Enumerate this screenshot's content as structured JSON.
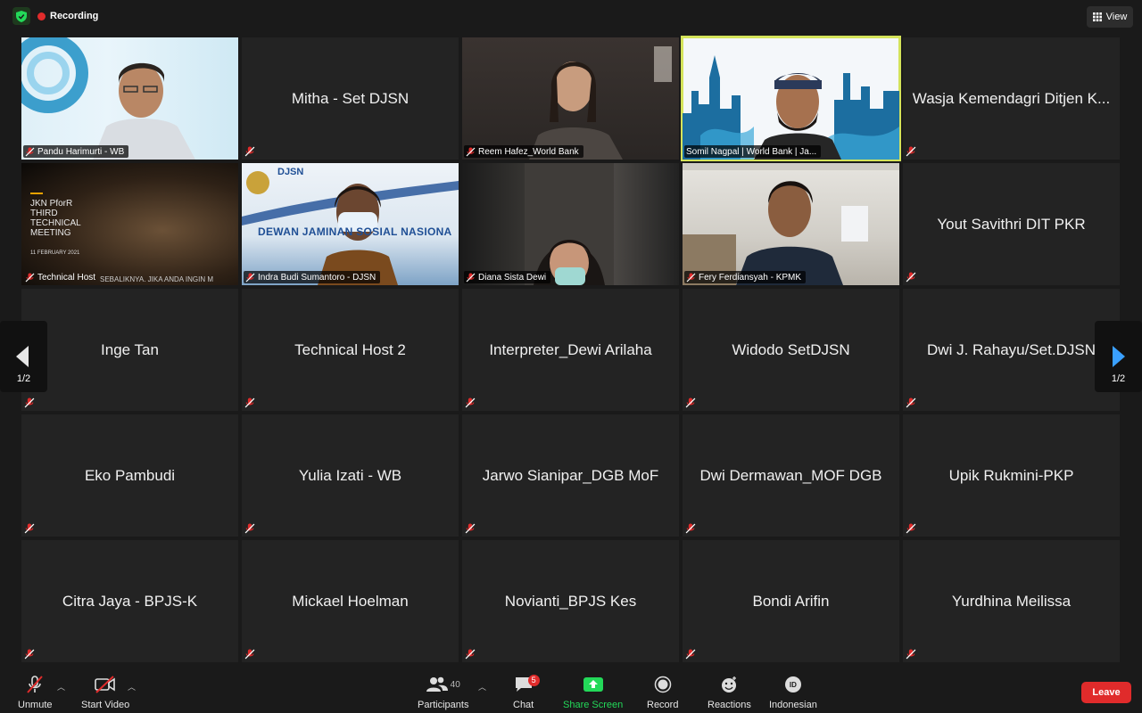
{
  "meeting": {
    "recording_label": "Recording",
    "view_label": "View",
    "page_indicator_left": "1/2",
    "page_indicator_right": "1/2"
  },
  "tiles": [
    {
      "name": "Pandu Harimurti - WB",
      "video": true,
      "muted": true
    },
    {
      "name": "Mitha - Set DJSN",
      "video": false,
      "muted": true
    },
    {
      "name": "Reem Hafez_World Bank",
      "video": true,
      "muted": true
    },
    {
      "name": "Somil Nagpal | World Bank | Ja...",
      "video": true,
      "muted": false,
      "active": true
    },
    {
      "name": "Wasja Kemendagri Ditjen K...",
      "video": false,
      "muted": true
    },
    {
      "name": "Technical Host",
      "video": true,
      "muted": true
    },
    {
      "name": "Indra Budi Sumantoro - DJSN",
      "video": true,
      "muted": true
    },
    {
      "name": "Diana Sista Dewi",
      "video": true,
      "muted": true
    },
    {
      "name": "Fery Ferdiansyah - KPMK",
      "video": true,
      "muted": true
    },
    {
      "name": "Yout Savithri DIT PKR",
      "video": false,
      "muted": true
    },
    {
      "name": "Inge Tan",
      "video": false,
      "muted": true
    },
    {
      "name": "Technical Host 2",
      "video": false,
      "muted": true
    },
    {
      "name": "Interpreter_Dewi Arilaha",
      "video": false,
      "muted": true
    },
    {
      "name": "Widodo SetDJSN",
      "video": false,
      "muted": true
    },
    {
      "name": "Dwi J. Rahayu/Set.DJSN",
      "video": false,
      "muted": true
    },
    {
      "name": "Eko Pambudi",
      "video": false,
      "muted": true
    },
    {
      "name": "Yulia Izati - WB",
      "video": false,
      "muted": true
    },
    {
      "name": "Jarwo Sianipar_DGB MoF",
      "video": false,
      "muted": true
    },
    {
      "name": "Dwi Dermawan_MOF DGB",
      "video": false,
      "muted": true
    },
    {
      "name": "Upik Rukmini-PKP",
      "video": false,
      "muted": true
    },
    {
      "name": "Citra Jaya - BPJS-K",
      "video": false,
      "muted": true
    },
    {
      "name": "Mickael Hoelman",
      "video": false,
      "muted": true
    },
    {
      "name": "Novianti_BPJS Kes",
      "video": false,
      "muted": true
    },
    {
      "name": "Bondi Arifin",
      "video": false,
      "muted": true
    },
    {
      "name": "Yurdhina Meilissa",
      "video": false,
      "muted": true
    }
  ],
  "shared_content": {
    "tech_slide_lines": [
      "JKN PforR",
      "THIRD",
      "TECHNICAL",
      "MEETING"
    ],
    "tech_slide_date": "11 FEBRUARY 2021",
    "tech_caption": "SEBALIKNYA.    JIKA ANDA INGIN M",
    "djsn_logo": "DJSN",
    "djsn_banner": "DEWAN JAMINAN SOSIAL NASIONA"
  },
  "toolbar": {
    "unmute": "Unmute",
    "start_video": "Start Video",
    "participants": "Participants",
    "participants_count": "40",
    "chat": "Chat",
    "chat_badge": "5",
    "share_screen": "Share Screen",
    "record": "Record",
    "reactions": "Reactions",
    "language": "Indonesian",
    "language_icon_text": "ID",
    "leave": "Leave"
  },
  "colors": {
    "accent_green": "#23d959",
    "leave_red": "#e02b2b",
    "active_speaker": "#d4e35a",
    "share_blue": "#4aa8ff"
  }
}
